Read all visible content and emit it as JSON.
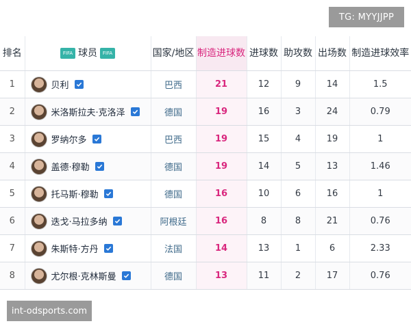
{
  "watermarks": {
    "top_right": "TG: MYYJJPP",
    "bottom_left": "int-odsports.com"
  },
  "table": {
    "headers": {
      "rank": "排名",
      "player": "球员",
      "country": "国家/地区",
      "created_goals": "制造进球数",
      "goals": "进球数",
      "assists": "助攻数",
      "appearances": "出场数",
      "efficiency": "制造进球效率"
    },
    "rows": [
      {
        "rank": "1",
        "player": "贝利",
        "country": "巴西",
        "created_goals": "21",
        "goals": "12",
        "assists": "9",
        "appearances": "14",
        "efficiency": "1.5"
      },
      {
        "rank": "2",
        "player": "米洛斯拉夫·克洛泽",
        "country": "德国",
        "created_goals": "19",
        "goals": "16",
        "assists": "3",
        "appearances": "24",
        "efficiency": "0.79"
      },
      {
        "rank": "3",
        "player": "罗纳尔多",
        "country": "巴西",
        "created_goals": "19",
        "goals": "15",
        "assists": "4",
        "appearances": "19",
        "efficiency": "1"
      },
      {
        "rank": "4",
        "player": "盖德·穆勒",
        "country": "德国",
        "created_goals": "19",
        "goals": "14",
        "assists": "5",
        "appearances": "13",
        "efficiency": "1.46"
      },
      {
        "rank": "5",
        "player": "托马斯·穆勒",
        "country": "德国",
        "created_goals": "16",
        "goals": "10",
        "assists": "6",
        "appearances": "16",
        "efficiency": "1"
      },
      {
        "rank": "6",
        "player": "迭戈·马拉多纳",
        "country": "阿根廷",
        "created_goals": "16",
        "goals": "8",
        "assists": "8",
        "appearances": "21",
        "efficiency": "0.76"
      },
      {
        "rank": "7",
        "player": "朱斯特·方丹",
        "country": "法国",
        "created_goals": "14",
        "goals": "13",
        "assists": "1",
        "appearances": "6",
        "efficiency": "2.33"
      },
      {
        "rank": "8",
        "player": "尤尔根·克林斯曼",
        "country": "德国",
        "created_goals": "13",
        "goals": "11",
        "assists": "2",
        "appearances": "17",
        "efficiency": "0.76"
      }
    ]
  },
  "colors": {
    "highlight": "#d9277e",
    "verify_badge": "#2a78d6",
    "header_icon": "#35b3a8"
  },
  "icons": {
    "header_left": "fifa-logo-icon",
    "header_right": "fifa-logo-icon",
    "verify": "verified-check-icon"
  }
}
